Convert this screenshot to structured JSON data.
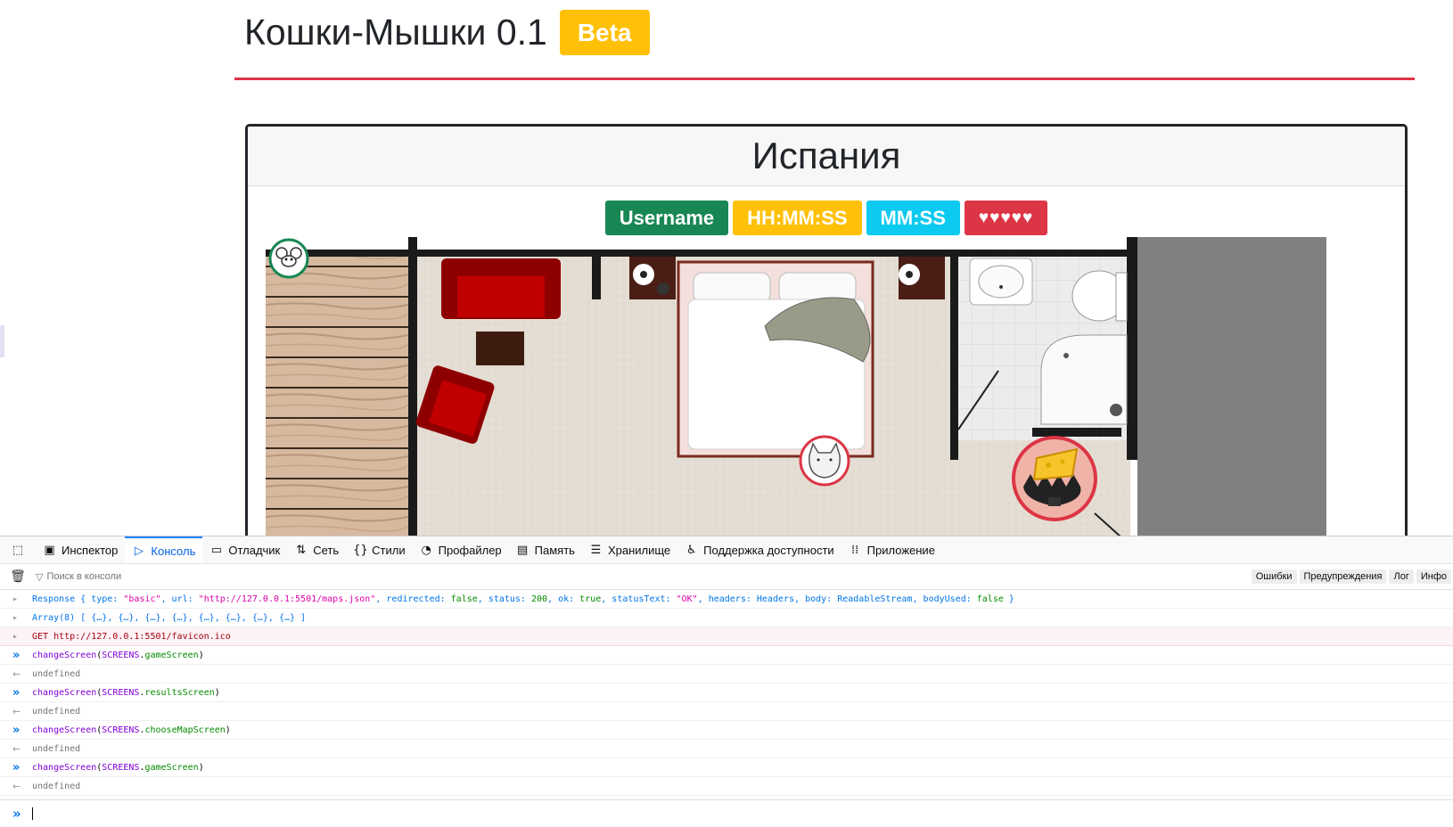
{
  "header": {
    "title": "Кошки-Мышки 0.1",
    "badge": "Beta"
  },
  "game": {
    "map_name": "Испания",
    "stats": {
      "username": "Username",
      "time": "HH:MM:SS",
      "timer": "MM:SS",
      "lives": "♥♥♥♥♥"
    }
  },
  "devtools": {
    "tabs": [
      {
        "icon": "cursor-select-icon",
        "label": ""
      },
      {
        "icon": "inspector-icon",
        "label": "Инспектор"
      },
      {
        "icon": "console-icon",
        "label": "Консоль",
        "active": true
      },
      {
        "icon": "debugger-icon",
        "label": "Отладчик"
      },
      {
        "icon": "network-icon",
        "label": "Сеть"
      },
      {
        "icon": "styles-icon",
        "label": "Стили"
      },
      {
        "icon": "profiler-icon",
        "label": "Профайлер"
      },
      {
        "icon": "memory-icon",
        "label": "Память"
      },
      {
        "icon": "storage-icon",
        "label": "Хранилище"
      },
      {
        "icon": "accessibility-icon",
        "label": "Поддержка доступности"
      },
      {
        "icon": "application-icon",
        "label": "Приложение"
      }
    ],
    "filter_placeholder": "Поиск в консоли",
    "filter_buttons": [
      "Ошибки",
      "Предупреждения",
      "Лог",
      "Инфо"
    ],
    "log": {
      "response": {
        "head": "Response { type: ",
        "type": "\"basic\"",
        "url_key": ", url: ",
        "url": "\"http://127.0.0.1:5501/maps.json\"",
        "redirected_key": ", redirected: ",
        "redirected": "false",
        "status_key": ", status: ",
        "status": "200",
        "ok_key": ", ok: ",
        "ok": "true",
        "statustext_key": ", statusText: ",
        "statustext": "\"OK\"",
        "headers_key": ", headers: ",
        "headers": "Headers",
        "body_key": ", body: ",
        "body": "ReadableStream",
        "bodyused_key": ", bodyUsed: ",
        "bodyused": "false",
        "tail": " }"
      },
      "array": "Array(8) [ {…}, {…}, {…}, {…}, {…}, {…}, {…}, {…} ]",
      "error": "GET http://127.0.0.1:5501/favicon.ico",
      "entries": [
        {
          "fn": "changeScreen",
          "arg_obj": "SCREENS",
          "arg_prop": "gameScreen",
          "result": "undefined"
        },
        {
          "fn": "changeScreen",
          "arg_obj": "SCREENS",
          "arg_prop": "resultsScreen",
          "result": "undefined"
        },
        {
          "fn": "changeScreen",
          "arg_obj": "SCREENS",
          "arg_prop": "chooseMapScreen",
          "result": "undefined"
        },
        {
          "fn": "changeScreen",
          "arg_obj": "SCREENS",
          "arg_prop": "gameScreen",
          "result": "undefined"
        }
      ]
    }
  }
}
